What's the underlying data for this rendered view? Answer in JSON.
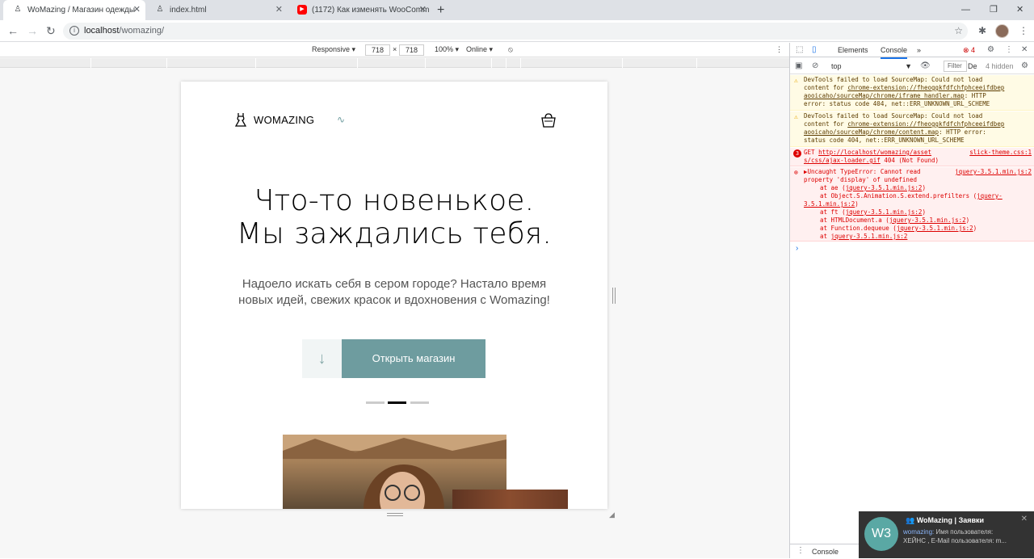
{
  "browser": {
    "tabs": [
      {
        "title": "WoMazing / Магазин одежды",
        "icon": "dress-icon",
        "active": true
      },
      {
        "title": "index.html",
        "icon": "dress-icon",
        "active": false
      },
      {
        "title": "(1172) Как изменять WooComm",
        "icon": "youtube-icon",
        "active": false
      }
    ],
    "new_tab": "+",
    "url_host": "localhost",
    "url_path": "/womazing/"
  },
  "device_toolbar": {
    "mode": "Responsive ▾",
    "width": "718",
    "height": "718",
    "times": "×",
    "zoom": "100% ▾",
    "network": "Online ▾"
  },
  "site": {
    "brand": "WOMAZING",
    "hero_title_line1": "Что-то новенькое.",
    "hero_title_line2": "Мы заждались тебя.",
    "hero_subtitle": "Надоело искать себя в сером городе? Настало время новых идей, свежих красок и вдохновения с Womazing!",
    "shop_button": "Открыть магазин",
    "scroll_arrow": "↓",
    "slides": [
      {
        "active": false
      },
      {
        "active": true
      },
      {
        "active": false
      }
    ],
    "accent_color": "#6e9c9f"
  },
  "devtools": {
    "tabs": {
      "elements": "Elements",
      "console": "Console",
      "more": "»"
    },
    "error_count": "4",
    "context": "top",
    "filter_placeholder": "Filter",
    "levels": "De",
    "hidden_count": "4 hidden",
    "messages": [
      {
        "type": "warn",
        "lines": [
          "DevTools failed to load SourceMap: Could not load",
          "content for ",
          "chrome-extension://fheoggkfdfchfphceeifdbep",
          "aooicaho/sourceMap/chrome/iframe_handler.map",
          ": HTTP",
          "error: status code 404, net::ERR_UNKNOWN_URL_SCHEME"
        ]
      },
      {
        "type": "warn",
        "lines": [
          "DevTools failed to load SourceMap: Could not load",
          "content for ",
          "chrome-extension://fheoggkfdfchfphceeifdbep",
          "aooicaho/sourceMap/chrome/content.map",
          ": HTTP error:",
          "status code 404, net::ERR_UNKNOWN_URL_SCHEME"
        ]
      },
      {
        "type": "err",
        "badge": "3",
        "text1": "GET ",
        "link1": "http://localhost/womazing/asset",
        "source": "slick-theme.css:1",
        "link2": "s/css/ajax-loader.gif",
        "text2": " 404 (Not Found)"
      },
      {
        "type": "err",
        "text1": "▶Uncaught TypeError: Cannot read",
        "source": "jquery-3.5.1.min.js:2",
        "text2": "property 'display' of undefined",
        "stack": [
          {
            "pre": "at ae (",
            "link": "jquery-3.5.1.min.js:2",
            "post": ")"
          },
          {
            "pre": "at Object.S.Animation.S.extend.prefilters (",
            "link": "jquery-",
            "post": ""
          },
          {
            "pre": "",
            "link": "3.5.1.min.js:2",
            "post": ")"
          },
          {
            "pre": "at ft (",
            "link": "jquery-3.5.1.min.js:2",
            "post": ")"
          },
          {
            "pre": "at HTMLDocument.a (",
            "link": "jquery-3.5.1.min.js:2",
            "post": ")"
          },
          {
            "pre": "at Function.dequeue (",
            "link": "jquery-3.5.1.min.js:2",
            "post": ")"
          },
          {
            "pre": "at ",
            "link": "jquery-3.5.1.min.js:2",
            "post": ""
          }
        ]
      }
    ],
    "prompt": "›",
    "drawer_tab": "Console"
  },
  "notification": {
    "avatar": "W3",
    "title": "WoMazing | Заявки",
    "sender": "womazing:",
    "body1": " Имя пользователя:",
    "body2": "ХЕЙНС , E-Mail пользователя: m..."
  }
}
